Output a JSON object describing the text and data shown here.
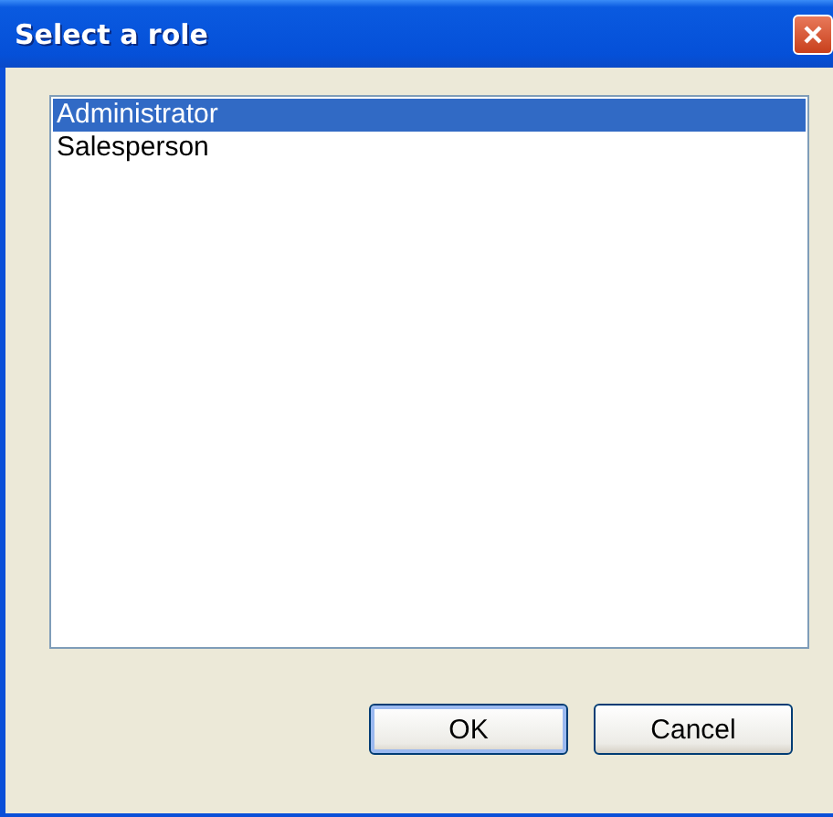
{
  "window": {
    "title": "Select a role"
  },
  "roles": [
    {
      "label": "Administrator",
      "selected": true
    },
    {
      "label": "Salesperson",
      "selected": false
    }
  ],
  "buttons": [
    {
      "label": "OK",
      "default": true
    },
    {
      "label": "Cancel",
      "default": false
    }
  ]
}
